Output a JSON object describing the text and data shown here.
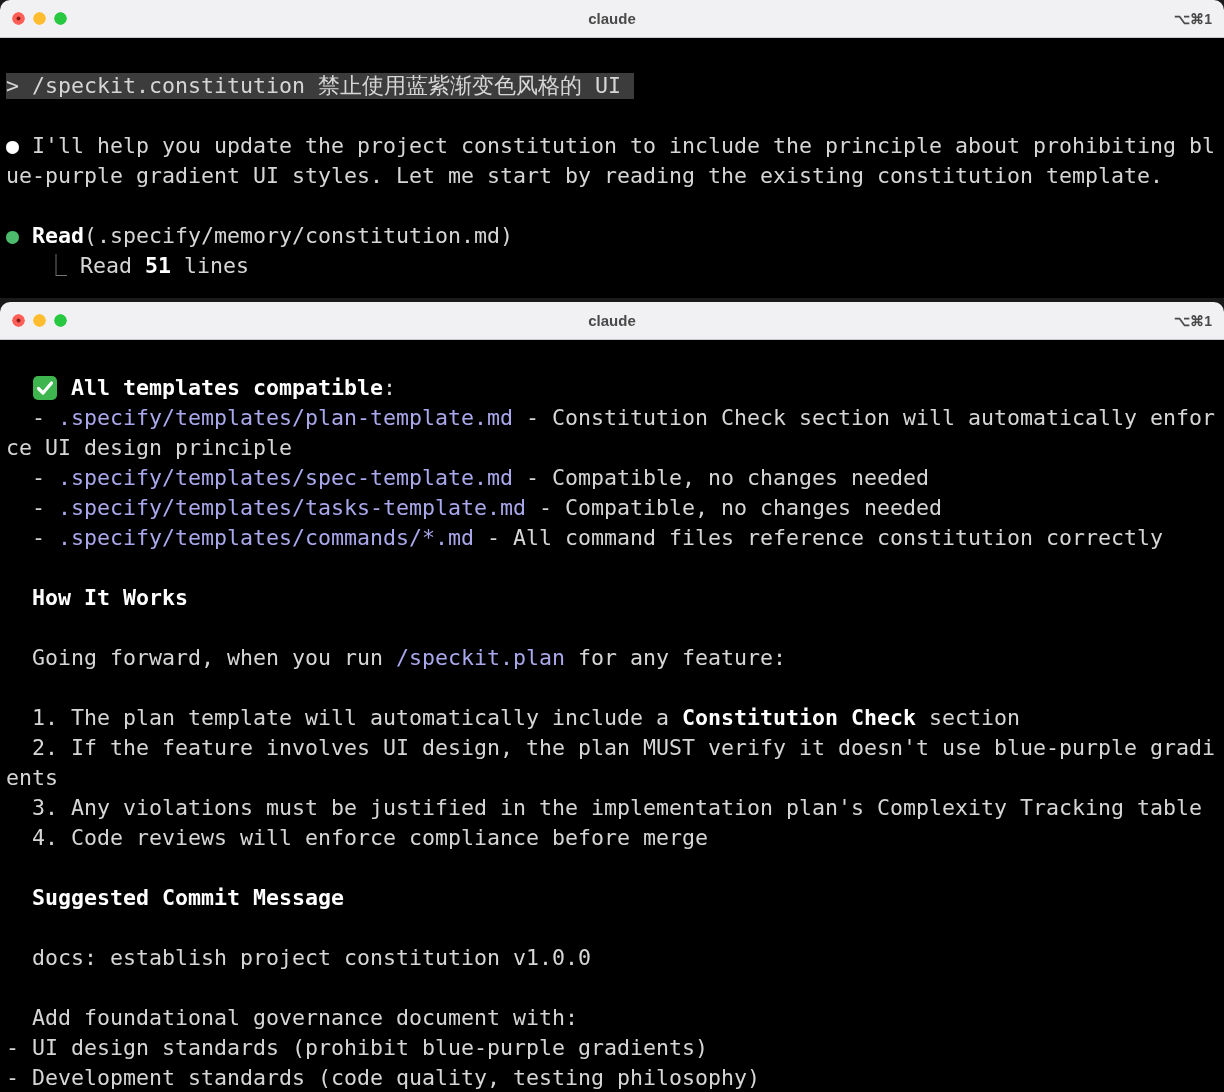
{
  "windows": [
    {
      "title": "claude",
      "shortcut": "⌥⌘1",
      "lines": [
        {
          "kind": "prompt",
          "text": "> /speckit.constitution 禁止使用蓝紫渐变色风格的 UI"
        },
        {
          "kind": "blank"
        },
        {
          "kind": "message",
          "marker": "●",
          "text": "I'll help you update the project constitution to include the principle about prohibiting bl"
        },
        {
          "kind": "wrap",
          "text": "ue-purple gradient UI styles. Let me start by reading the existing constitution template."
        },
        {
          "kind": "blank"
        },
        {
          "kind": "tool",
          "marker": "●",
          "text": "**Read**(.specify/memory/constitution.md)"
        },
        {
          "kind": "result",
          "connector": "⎿",
          "text": "Read **51** lines"
        }
      ]
    },
    {
      "title": "claude",
      "shortcut": "⌥⌘1",
      "lines": [
        {
          "kind": "check",
          "text": "**All templates compatible**:"
        },
        {
          "kind": "path",
          "bullet": "-",
          "path": ".specify/templates/plan-template.md",
          "rest": "- Constitution Check section will automatically enfor"
        },
        {
          "kind": "wrap",
          "text": "ce UI design principle"
        },
        {
          "kind": "path",
          "bullet": "-",
          "path": ".specify/templates/spec-template.md",
          "rest": "- Compatible, no changes needed"
        },
        {
          "kind": "path",
          "bullet": "-",
          "path": ".specify/templates/tasks-template.md",
          "rest": "- Compatible, no changes needed"
        },
        {
          "kind": "path",
          "bullet": "-",
          "path": ".specify/templates/commands/*.md",
          "rest": "- All command files reference constitution correctly"
        },
        {
          "kind": "blank"
        },
        {
          "kind": "heading",
          "text": "How It Works"
        },
        {
          "kind": "blank"
        },
        {
          "kind": "command-ref",
          "before": "Going forward, when you run",
          "command": "/speckit.plan",
          "after": "for any feature:"
        },
        {
          "kind": "blank"
        },
        {
          "kind": "body",
          "text": "1. The plan template will automatically include a **Constitution Check** section"
        },
        {
          "kind": "body",
          "text": "2. If the feature involves UI design, the plan MUST verify it doesn't use blue-purple gradi"
        },
        {
          "kind": "wrap",
          "text": "ents"
        },
        {
          "kind": "body",
          "text": "3. Any violations must be justified in the implementation plan's Complexity Tracking table"
        },
        {
          "kind": "body",
          "text": "4. Code reviews will enforce compliance before merge"
        },
        {
          "kind": "blank"
        },
        {
          "kind": "heading",
          "text": "Suggested Commit Message"
        },
        {
          "kind": "blank"
        },
        {
          "kind": "body",
          "text": "docs: establish project constitution v1.0.0"
        },
        {
          "kind": "blank"
        },
        {
          "kind": "body",
          "text": "Add foundational governance document with:"
        },
        {
          "kind": "wrap",
          "text": "- UI design standards (prohibit blue-purple gradients)"
        },
        {
          "kind": "wrap",
          "text": "- Development standards (code quality, testing philosophy)"
        }
      ]
    }
  ]
}
